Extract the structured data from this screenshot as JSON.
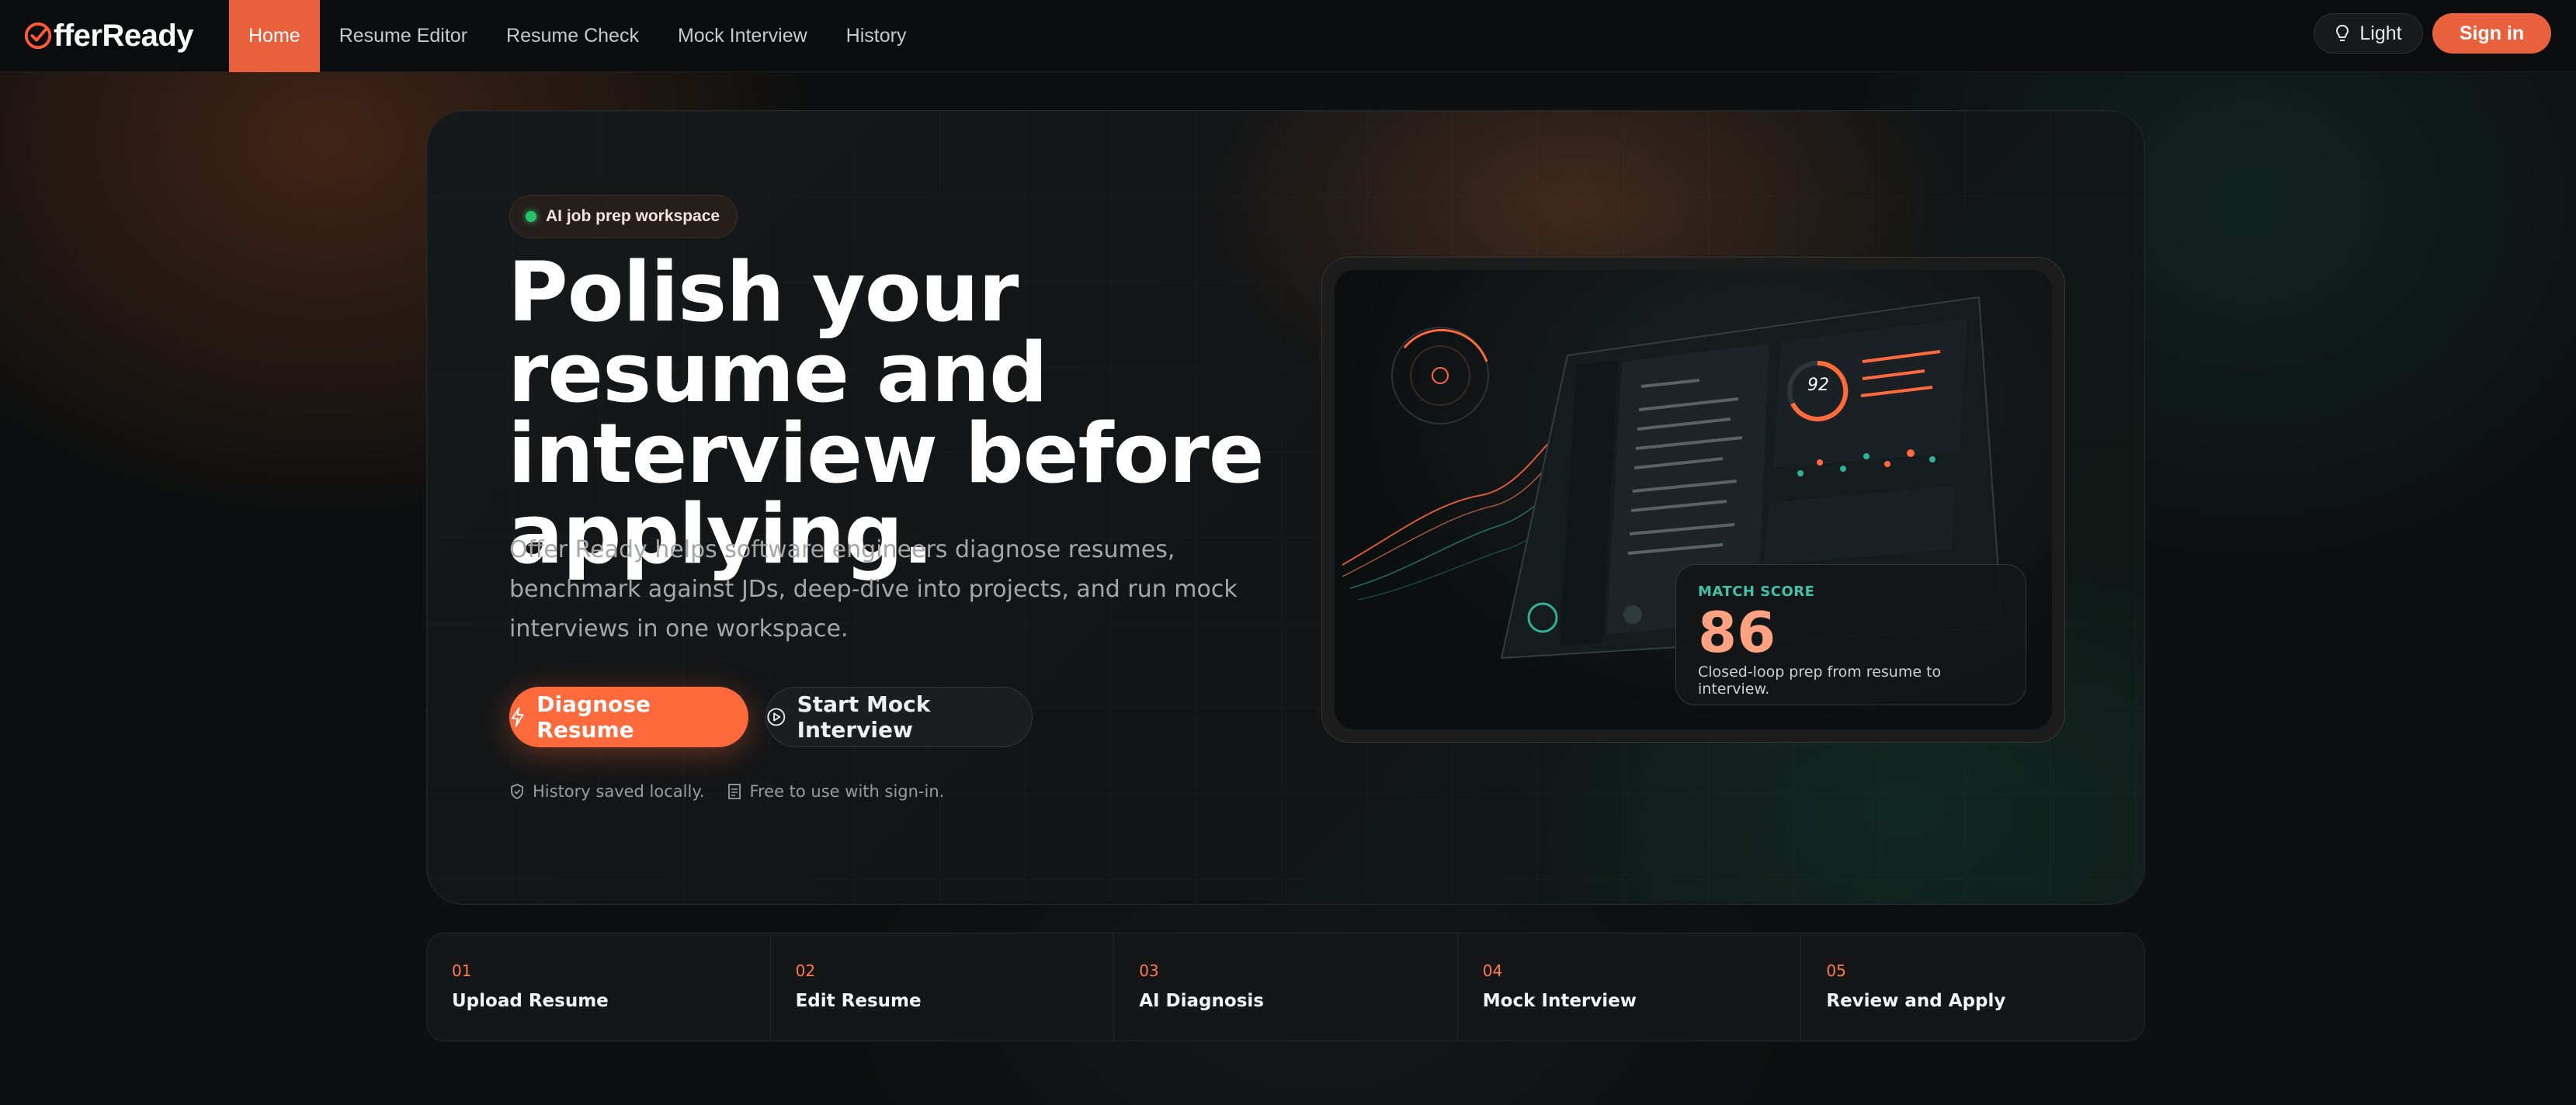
{
  "nav": {
    "logo_text": "fferReady",
    "links": [
      {
        "label": "Home",
        "active": true
      },
      {
        "label": "Resume Editor",
        "active": false
      },
      {
        "label": "Resume Check",
        "active": false
      },
      {
        "label": "Mock Interview",
        "active": false
      },
      {
        "label": "History",
        "active": false
      }
    ],
    "theme_label": "Light",
    "theme_icon": "bulb-icon",
    "signin_label": "Sign in"
  },
  "hero": {
    "badge": "AI job prep workspace",
    "headline": "Polish your resume and interview before applying.",
    "subtext": "Offer Ready helps software engineers diagnose resumes, benchmark against JDs, deep-dive into projects, and run mock interviews in one workspace.",
    "primary_button": "Diagnose Resume",
    "primary_icon": "lightning-icon",
    "secondary_button": "Start Mock Interview",
    "secondary_icon": "play-circle-icon",
    "notes": [
      {
        "icon": "shield-check-icon",
        "text": "History saved locally."
      },
      {
        "icon": "document-icon",
        "text": "Free to use with sign-in."
      }
    ]
  },
  "preview": {
    "dashboard_score": "92",
    "match_label": "MATCH SCORE",
    "match_score": "86",
    "match_desc": "Closed-loop prep from resume to interview."
  },
  "steps": [
    {
      "num": "01",
      "title": "Upload Resume"
    },
    {
      "num": "02",
      "title": "Edit Resume"
    },
    {
      "num": "03",
      "title": "AI Diagnosis"
    },
    {
      "num": "04",
      "title": "Mock Interview"
    },
    {
      "num": "05",
      "title": "Review and Apply"
    }
  ],
  "colors": {
    "accent": "#e8613c",
    "accent_bright": "#ff6a3d",
    "teal": "#3fc2a8",
    "background": "#0d0f10"
  }
}
